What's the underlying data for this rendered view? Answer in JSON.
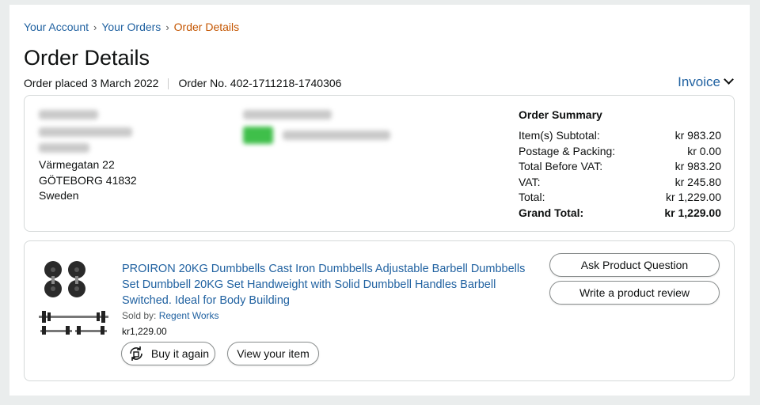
{
  "breadcrumb": {
    "account": "Your Account",
    "orders": "Your Orders",
    "current": "Order Details",
    "separator": "›"
  },
  "page_title": "Order Details",
  "order_meta": {
    "placed": "Order placed 3 March 2022",
    "number": "Order No. 402-1711218-1740306"
  },
  "invoice_label": "Invoice",
  "shipping_address": {
    "street": "Värmegatan 22",
    "city": "GÖTEBORG 41832",
    "country": "Sweden"
  },
  "summary": {
    "title": "Order Summary",
    "rows": [
      {
        "label": "Item(s) Subtotal:",
        "value": "kr 983.20"
      },
      {
        "label": "Postage & Packing:",
        "value": "kr 0.00"
      },
      {
        "label": "Total Before VAT:",
        "value": "kr 983.20"
      },
      {
        "label": "VAT:",
        "value": "kr 245.80"
      },
      {
        "label": "Total:",
        "value": "kr 1,229.00"
      }
    ],
    "grand_total_label": "Grand Total:",
    "grand_total_value": "kr 1,229.00"
  },
  "product": {
    "title": "PROIRON 20KG Dumbbells Cast Iron Dumbbells Adjustable Barbell Dumbbells Set Dumbbell 20KG Set Handweight with Solid Dumbbell Handles Barbell Switched. Ideal for Body Building",
    "sold_by_label": "Sold by:",
    "seller": "Regent Works",
    "price": "kr1,229.00",
    "buy_again": "Buy it again",
    "view_item": "View your item",
    "ask_question": "Ask Product Question",
    "write_review": "Write a product review"
  },
  "icons": {
    "invoice": "chevron-down-icon",
    "buy_again": "reorder-icon",
    "product": "dumbbell-set-image"
  },
  "colors": {
    "link": "#2162a1",
    "breadcrumb_current": "#c45500",
    "border": "#d5d9d9",
    "background": "#eaeded"
  }
}
